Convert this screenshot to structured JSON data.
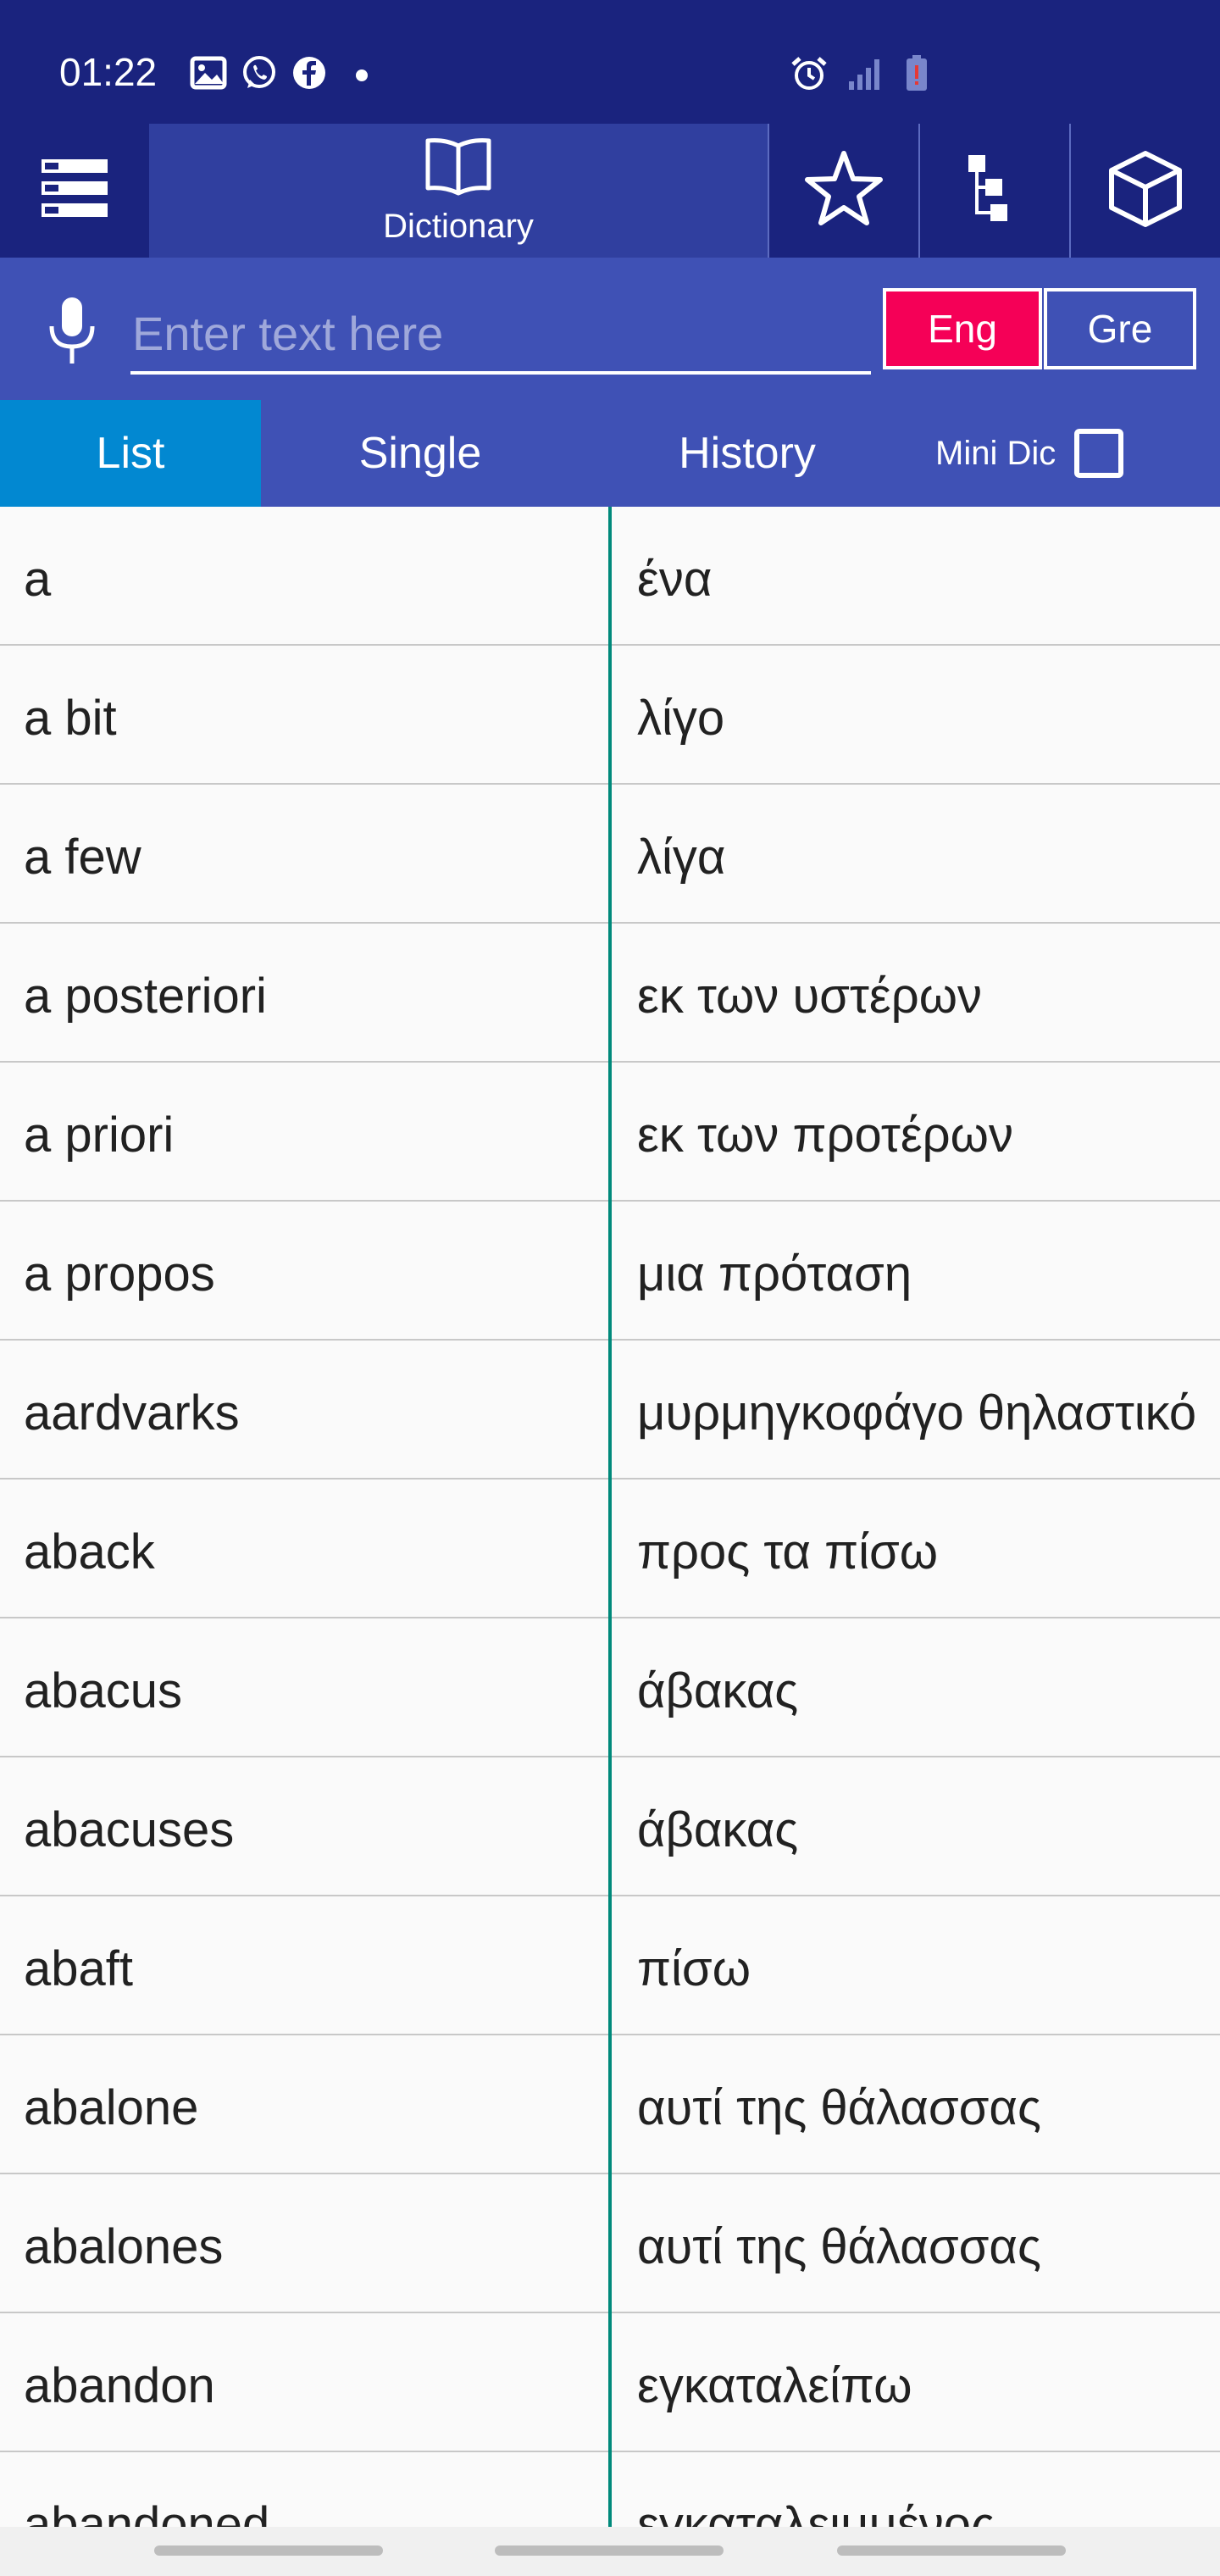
{
  "status_bar": {
    "time": "01:22",
    "left_icons": [
      "gallery-icon",
      "whatsapp-icon",
      "facebook-icon",
      "dot-icon"
    ],
    "right_icons": [
      "alarm-icon",
      "signal-icon",
      "battery-low-icon"
    ]
  },
  "toolbar": {
    "active_tab_label": "Dictionary",
    "icons": [
      "menu-icon",
      "book-icon",
      "star-icon",
      "tree-icon",
      "cube-icon"
    ]
  },
  "search": {
    "placeholder": "Enter text here",
    "value": "",
    "lang_eng": "Eng",
    "lang_gre": "Gre",
    "active_lang": "Eng"
  },
  "tabs": {
    "list": "List",
    "single": "Single",
    "history": "History",
    "mini_dic": "Mini Dic",
    "active": "List",
    "mini_dic_checked": false
  },
  "entries": [
    {
      "en": "a",
      "gr": "ένα"
    },
    {
      "en": "a bit",
      "gr": "λίγο"
    },
    {
      "en": "a few",
      "gr": "λίγα"
    },
    {
      "en": "a posteriori",
      "gr": "εκ των υστέρων"
    },
    {
      "en": "a priori",
      "gr": "εκ των προτέρων"
    },
    {
      "en": "a propos",
      "gr": "μια πρόταση"
    },
    {
      "en": "aardvarks",
      "gr": "μυρμηγκοφάγο θηλαστικό"
    },
    {
      "en": "aback",
      "gr": "προς τα πίσω"
    },
    {
      "en": "abacus",
      "gr": "άβακας"
    },
    {
      "en": "abacuses",
      "gr": "άβακας"
    },
    {
      "en": "abaft",
      "gr": "πίσω"
    },
    {
      "en": "abalone",
      "gr": "αυτί της θάλασσας"
    },
    {
      "en": "abalones",
      "gr": "αυτί της θάλασσας"
    },
    {
      "en": "abandon",
      "gr": "εγκαταλείπω"
    },
    {
      "en": "abandoned",
      "gr": "εγκαταλειμμένος"
    }
  ],
  "colors": {
    "header": "#1a237e",
    "active_tab": "#303f9f",
    "search_bar": "#3f51b5",
    "list_tab_active": "#0288d1",
    "eng_button": "#f50057",
    "column_divider": "#00897b"
  }
}
